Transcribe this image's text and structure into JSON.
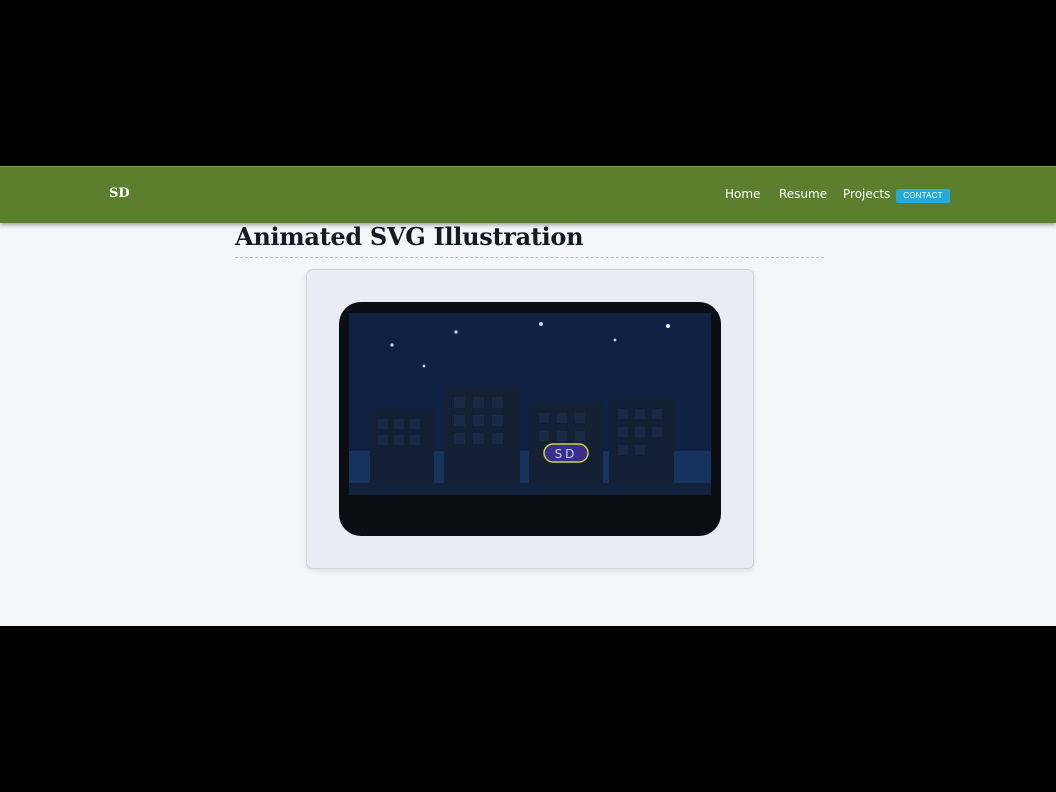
{
  "nav": {
    "brand": "SD",
    "links": [
      {
        "label": "Home"
      },
      {
        "label": "Resume"
      },
      {
        "label": "Projects"
      }
    ],
    "contact_label": "CONTACT"
  },
  "main": {
    "title": "Animated SVG Illustration"
  },
  "illustration": {
    "badge_text": "SD",
    "colors": {
      "sky": "#0f2244",
      "ground": "#0b0f13",
      "badge_fill": "#3a2f8c",
      "badge_stroke": "#c5d63a",
      "nav_bg": "#5c7f2d",
      "contact_bg": "#22a9dd"
    }
  }
}
